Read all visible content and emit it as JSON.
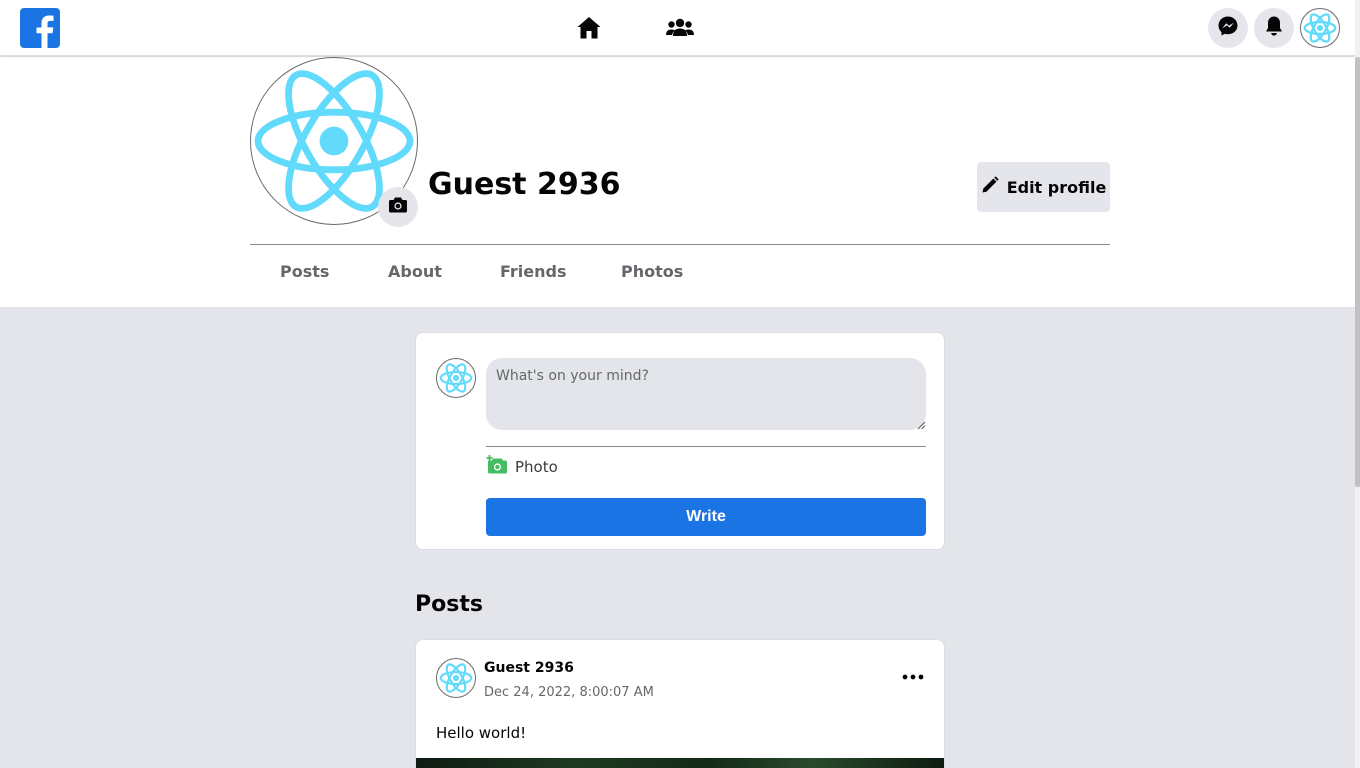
{
  "topbar": {
    "logo_icon": "facebook-logo-icon",
    "nav": [
      {
        "icon": "home-icon"
      },
      {
        "icon": "friends-icon"
      }
    ],
    "actions": [
      {
        "icon": "messenger-icon"
      },
      {
        "icon": "bell-icon"
      },
      {
        "icon": "react-atom-avatar-icon"
      }
    ]
  },
  "profile": {
    "name": "Guest 2936",
    "edit_label": "Edit profile",
    "tabs": [
      "Posts",
      "About",
      "Friends",
      "Photos"
    ]
  },
  "composer": {
    "placeholder": "What's on your mind?",
    "photo_label": "Photo",
    "write_label": "Write"
  },
  "posts": {
    "heading": "Posts",
    "items": [
      {
        "author": "Guest 2936",
        "date": "Dec 24, 2022, 8:00:07 AM",
        "text": "Hello world!"
      }
    ]
  },
  "colors": {
    "brand": "#1b74e4",
    "react": "#61dafb",
    "page_bg": "#e4e5ea",
    "photo_green": "#45bd62"
  }
}
